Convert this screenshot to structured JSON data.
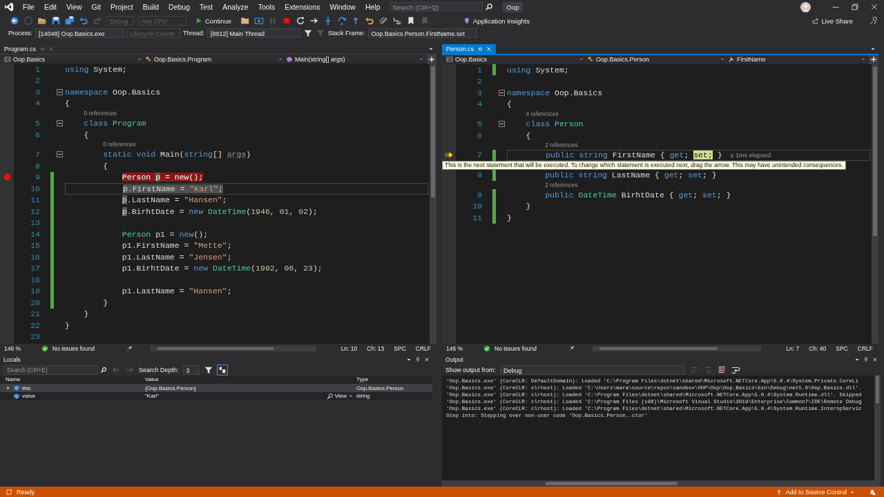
{
  "menu": [
    "File",
    "Edit",
    "View",
    "Git",
    "Project",
    "Build",
    "Debug",
    "Test",
    "Analyze",
    "Tools",
    "Extensions",
    "Window",
    "Help"
  ],
  "search": {
    "placeholder": "Search (Ctrl+Q)"
  },
  "solution_name": "Oop",
  "toolbar": {
    "configuration": {
      "text": "Debug",
      "disabled": true
    },
    "platform": {
      "text": "Any CPU",
      "disabled": true
    },
    "continue_label": "Continue",
    "insights_label": "Application Insights",
    "live_share_label": "Live Share"
  },
  "debug_location": {
    "process_label": "Process:",
    "process": "[14048] Oop.Basics.exe",
    "lifecycle": {
      "text": "Lifecycle Events",
      "disabled": true
    },
    "thread_label": "Thread:",
    "thread": "[8912] Main Thread",
    "stack_frame_label": "Stack Frame:",
    "stack_frame": "Oop.Basics.Person.FirstName.set"
  },
  "editors": [
    {
      "tab": {
        "label": "Program.cs",
        "selected": false
      },
      "nav": [
        {
          "text": "Oop.Basics",
          "kind": "project"
        },
        {
          "text": "Oop.Basics.Program",
          "kind": "class"
        },
        {
          "text": "Main(string[] args)",
          "kind": "method"
        }
      ],
      "lines": [
        {
          "kind": "code",
          "number": "1",
          "changed": false,
          "fold": false,
          "breakpoint": false,
          "next": false,
          "current": false,
          "caller": false,
          "tokens": [
            {
              "text": "using",
              "kind": "kw"
            },
            {
              "text": " System;",
              "kind": "plain"
            }
          ]
        },
        {
          "kind": "code",
          "number": "2",
          "changed": false,
          "fold": false,
          "breakpoint": false,
          "next": false,
          "current": false,
          "caller": false
        },
        {
          "kind": "code",
          "number": "3",
          "changed": false,
          "fold": true,
          "breakpoint": false,
          "next": false,
          "current": false,
          "caller": false,
          "tokens": [
            {
              "text": "namespace",
              "kind": "kw"
            },
            {
              "text": " Oop.Basics",
              "kind": "plain"
            }
          ]
        },
        {
          "kind": "code",
          "number": "4",
          "changed": false,
          "fold": false,
          "breakpoint": false,
          "next": false,
          "current": false,
          "caller": false,
          "tokens": [
            {
              "text": "{",
              "kind": "plain"
            }
          ]
        },
        {
          "kind": "lens",
          "text": "    0 references"
        },
        {
          "kind": "code",
          "number": "5",
          "changed": false,
          "fold": true,
          "breakpoint": false,
          "next": false,
          "current": false,
          "caller": false,
          "tokens": [
            {
              "text": "    class",
              "kind": "kw"
            },
            {
              "text": " Program",
              "kind": "type"
            }
          ]
        },
        {
          "kind": "code",
          "number": "6",
          "changed": false,
          "fold": false,
          "breakpoint": false,
          "next": false,
          "current": false,
          "caller": false,
          "tokens": [
            {
              "text": "    {",
              "kind": "plain"
            }
          ]
        },
        {
          "kind": "lens",
          "text": "        0 references"
        },
        {
          "kind": "code",
          "number": "7",
          "changed": false,
          "fold": true,
          "breakpoint": false,
          "next": false,
          "current": false,
          "caller": false,
          "tokens": [
            {
              "text": "        static",
              "kind": "kw"
            },
            {
              "text": " void",
              "kind": "kw"
            },
            {
              "text": " Main(",
              "kind": "plain"
            },
            {
              "text": "string",
              "kind": "kw"
            },
            {
              "text": "[] ",
              "kind": "plain"
            },
            {
              "text": "args",
              "kind": "unused"
            },
            {
              "text": ")",
              "kind": "plain"
            }
          ]
        },
        {
          "kind": "code",
          "number": "8",
          "changed": false,
          "fold": false,
          "breakpoint": false,
          "next": false,
          "current": false,
          "caller": false,
          "tokens": [
            {
              "text": "        {",
              "kind": "plain"
            }
          ]
        },
        {
          "kind": "code",
          "number": "9",
          "changed": true,
          "fold": false,
          "breakpoint": true,
          "next": false,
          "current": false,
          "caller": false,
          "tokens": [
            {
              "text": "            Person ",
              "kind": "plain"
            },
            {
              "text": "p",
              "kind": "ref"
            },
            {
              "text": " = new();",
              "kind": "plain"
            }
          ]
        },
        {
          "kind": "code",
          "number": "10",
          "changed": true,
          "fold": false,
          "breakpoint": false,
          "next": false,
          "current": true,
          "caller": true,
          "tokens": [
            {
              "text": "            p",
              "kind": "ref"
            },
            {
              "text": ".FirstName = ",
              "kind": "plain"
            },
            {
              "text": "\"Karl\"",
              "kind": "str"
            },
            {
              "text": ";",
              "kind": "plain"
            }
          ]
        },
        {
          "kind": "code",
          "number": "11",
          "changed": true,
          "fold": false,
          "breakpoint": false,
          "next": false,
          "current": false,
          "caller": false,
          "tokens": [
            {
              "text": "            p",
              "kind": "ref"
            },
            {
              "text": ".LastName = ",
              "kind": "plain"
            },
            {
              "text": "\"Hansen\"",
              "kind": "str"
            },
            {
              "text": ";",
              "kind": "plain"
            }
          ]
        },
        {
          "kind": "code",
          "number": "12",
          "changed": true,
          "fold": false,
          "breakpoint": false,
          "next": false,
          "current": false,
          "caller": false,
          "tokens": [
            {
              "text": "            p",
              "kind": "ref"
            },
            {
              "text": ".BirhtDate = ",
              "kind": "plain"
            },
            {
              "text": "new",
              "kind": "kw"
            },
            {
              "text": " DateTime",
              "kind": "type"
            },
            {
              "text": "(",
              "kind": "plain"
            },
            {
              "text": "1946",
              "kind": "num"
            },
            {
              "text": ", ",
              "kind": "plain"
            },
            {
              "text": "01",
              "kind": "num"
            },
            {
              "text": ", ",
              "kind": "plain"
            },
            {
              "text": "02",
              "kind": "num"
            },
            {
              "text": ");",
              "kind": "plain"
            }
          ]
        },
        {
          "kind": "code",
          "number": "13",
          "changed": true,
          "fold": false,
          "breakpoint": false,
          "next": false,
          "current": false,
          "caller": false
        },
        {
          "kind": "code",
          "number": "14",
          "changed": true,
          "fold": false,
          "breakpoint": false,
          "next": false,
          "current": false,
          "caller": false,
          "tokens": [
            {
              "text": "            Person",
              "kind": "type"
            },
            {
              "text": " p1 = ",
              "kind": "plain"
            },
            {
              "text": "new",
              "kind": "kw"
            },
            {
              "text": "();",
              "kind": "plain"
            }
          ]
        },
        {
          "kind": "code",
          "number": "15",
          "changed": true,
          "fold": false,
          "breakpoint": false,
          "next": false,
          "current": false,
          "caller": false,
          "tokens": [
            {
              "text": "            p1.FirstName = ",
              "kind": "plain"
            },
            {
              "text": "\"Mette\"",
              "kind": "str"
            },
            {
              "text": ";",
              "kind": "plain"
            }
          ]
        },
        {
          "kind": "code",
          "number": "16",
          "changed": true,
          "fold": false,
          "breakpoint": false,
          "next": false,
          "current": false,
          "caller": false,
          "tokens": [
            {
              "text": "            p1.LastName = ",
              "kind": "plain"
            },
            {
              "text": "\"Jensen\"",
              "kind": "str"
            },
            {
              "text": ";",
              "kind": "plain"
            }
          ]
        },
        {
          "kind": "code",
          "number": "17",
          "changed": true,
          "fold": false,
          "breakpoint": false,
          "next": false,
          "current": false,
          "caller": false,
          "tokens": [
            {
              "text": "            p1.BirhtDate = ",
              "kind": "plain"
            },
            {
              "text": "new",
              "kind": "kw"
            },
            {
              "text": " DateTime",
              "kind": "type"
            },
            {
              "text": "(",
              "kind": "plain"
            },
            {
              "text": "1992",
              "kind": "num"
            },
            {
              "text": ", ",
              "kind": "plain"
            },
            {
              "text": "06",
              "kind": "num"
            },
            {
              "text": ", ",
              "kind": "plain"
            },
            {
              "text": "23",
              "kind": "num"
            },
            {
              "text": ");",
              "kind": "plain"
            }
          ]
        },
        {
          "kind": "code",
          "number": "18",
          "changed": true,
          "fold": false,
          "breakpoint": false,
          "next": false,
          "current": false,
          "caller": false
        },
        {
          "kind": "code",
          "number": "19",
          "changed": true,
          "fold": false,
          "breakpoint": false,
          "next": false,
          "current": false,
          "caller": false,
          "tokens": [
            {
              "text": "            p1.LastName = ",
              "kind": "plain"
            },
            {
              "text": "\"Hansen\"",
              "kind": "str"
            },
            {
              "text": ";",
              "kind": "plain"
            }
          ]
        },
        {
          "kind": "code",
          "number": "20",
          "changed": true,
          "fold": false,
          "breakpoint": false,
          "next": false,
          "current": false,
          "caller": false,
          "tokens": [
            {
              "text": "        }",
              "kind": "plain"
            }
          ]
        },
        {
          "kind": "code",
          "number": "21",
          "changed": false,
          "fold": false,
          "breakpoint": false,
          "next": false,
          "current": false,
          "caller": false,
          "tokens": [
            {
              "text": "    }",
              "kind": "plain"
            }
          ]
        },
        {
          "kind": "code",
          "number": "22",
          "changed": false,
          "fold": false,
          "breakpoint": false,
          "next": false,
          "current": false,
          "caller": false,
          "tokens": [
            {
              "text": "}",
              "kind": "plain"
            }
          ]
        },
        {
          "kind": "code",
          "number": "23",
          "changed": false,
          "fold": false,
          "breakpoint": false,
          "next": false,
          "current": false,
          "caller": false
        }
      ],
      "status": {
        "zoom": "146 %",
        "issues": "No issues found",
        "line": "Ln: 10",
        "column": "Ch: 13",
        "indent": "SPC",
        "line_ending": "CRLF"
      }
    },
    {
      "tab": {
        "label": "Person.cs",
        "selected": true
      },
      "nav": [
        {
          "text": "Oop.Basics",
          "kind": "project"
        },
        {
          "text": "Oop.Basics.Person",
          "kind": "class"
        },
        {
          "text": "FirstName",
          "kind": "property"
        }
      ],
      "lines": [
        {
          "kind": "code",
          "number": "1",
          "changed": true,
          "fold": false,
          "breakpoint": false,
          "next": false,
          "current": false,
          "caller": false,
          "tokens": [
            {
              "text": "using",
              "kind": "kw"
            },
            {
              "text": " System;",
              "kind": "plain"
            }
          ]
        },
        {
          "kind": "code",
          "number": "2",
          "changed": false,
          "fold": false,
          "breakpoint": false,
          "next": false,
          "current": false,
          "caller": false
        },
        {
          "kind": "code",
          "number": "3",
          "changed": false,
          "fold": true,
          "breakpoint": false,
          "next": false,
          "current": false,
          "caller": false,
          "tokens": [
            {
              "text": "namespace",
              "kind": "kw"
            },
            {
              "text": " Oop.Basics",
              "kind": "plain"
            }
          ]
        },
        {
          "kind": "code",
          "number": "4",
          "changed": false,
          "fold": false,
          "breakpoint": false,
          "next": false,
          "current": false,
          "caller": false,
          "tokens": [
            {
              "text": "{",
              "kind": "plain"
            }
          ]
        },
        {
          "kind": "lens",
          "text": "    4 references"
        },
        {
          "kind": "code",
          "number": "5",
          "changed": false,
          "fold": true,
          "breakpoint": false,
          "next": false,
          "current": false,
          "caller": false,
          "tokens": [
            {
              "text": "    class",
              "kind": "kw"
            },
            {
              "text": " Person",
              "kind": "type"
            }
          ]
        },
        {
          "kind": "code",
          "number": "6",
          "changed": false,
          "fold": false,
          "breakpoint": false,
          "next": false,
          "current": false,
          "caller": false,
          "tokens": [
            {
              "text": "    {",
              "kind": "plain"
            }
          ]
        },
        {
          "kind": "lens",
          "text": "        2 references"
        },
        {
          "kind": "code",
          "number": "7",
          "changed": true,
          "fold": false,
          "breakpoint": false,
          "next": true,
          "current": true,
          "caller": false,
          "tip": "≤ 1ms elapsed",
          "tokens": [
            {
              "text": "        public",
              "kind": "kw"
            },
            {
              "text": " string",
              "kind": "kw"
            },
            {
              "text": " FirstName { ",
              "kind": "plain"
            },
            {
              "text": "get",
              "kind": "kw"
            },
            {
              "text": "; ",
              "kind": "plain"
            },
            {
              "text": "set;",
              "kind": "hl"
            },
            {
              "text": " }",
              "kind": "plain"
            }
          ]
        },
        {
          "kind": "tooltip",
          "text": "This is the next statement that will be executed. To change which statement is executed next, drag the arrow. This may have unintended consequences."
        },
        {
          "kind": "code",
          "number": "8",
          "changed": true,
          "fold": false,
          "breakpoint": false,
          "next": false,
          "current": false,
          "caller": false,
          "tokens": [
            {
              "text": "        public",
              "kind": "kw"
            },
            {
              "text": " string",
              "kind": "kw"
            },
            {
              "text": " LastName { ",
              "kind": "plain"
            },
            {
              "text": "get",
              "kind": "kw"
            },
            {
              "text": "; ",
              "kind": "plain"
            },
            {
              "text": "set",
              "kind": "kw"
            },
            {
              "text": "; }",
              "kind": "plain"
            }
          ]
        },
        {
          "kind": "lens",
          "text": "        2 references"
        },
        {
          "kind": "code",
          "number": "9",
          "changed": true,
          "fold": false,
          "breakpoint": false,
          "next": false,
          "current": false,
          "caller": false,
          "tokens": [
            {
              "text": "        public",
              "kind": "kw"
            },
            {
              "text": " DateTime",
              "kind": "type"
            },
            {
              "text": " BirhtDate { ",
              "kind": "plain"
            },
            {
              "text": "get",
              "kind": "kw"
            },
            {
              "text": "; ",
              "kind": "plain"
            },
            {
              "text": "set",
              "kind": "kw"
            },
            {
              "text": "; }",
              "kind": "plain"
            }
          ]
        },
        {
          "kind": "code",
          "number": "10",
          "changed": true,
          "fold": false,
          "breakpoint": false,
          "next": false,
          "current": false,
          "caller": false,
          "tokens": [
            {
              "text": "    }",
              "kind": "plain"
            }
          ]
        },
        {
          "kind": "code",
          "number": "11",
          "changed": true,
          "fold": false,
          "breakpoint": false,
          "next": false,
          "current": false,
          "caller": false,
          "tokens": [
            {
              "text": "}",
              "kind": "plain"
            }
          ]
        }
      ],
      "status": {
        "zoom": "146 %",
        "issues": "No issues found",
        "line": "Ln: 7",
        "column": "Ch: 40",
        "indent": "SPC",
        "line_ending": "CRLF"
      }
    }
  ],
  "locals": {
    "title": "Locals",
    "search": {
      "placeholder": "Search (Ctrl+E)"
    },
    "depth_label": "Search Depth:",
    "depth": "3",
    "columns": [
      "Name",
      "Value",
      "Type"
    ],
    "rows": [
      {
        "name": "this",
        "value": "{Oop.Basics.Person}",
        "type": "Oop.Basics.Person",
        "expandable": true,
        "selected": true
      },
      {
        "name": "value",
        "value": "\"Karl\"",
        "type": "string",
        "expandable": false,
        "selected": false,
        "visualizer": "View"
      }
    ]
  },
  "output": {
    "title": "Output",
    "source_label": "Show output from:",
    "source": "Debug",
    "lines": [
      "'Oop.Basics.exe' (CoreCLR: DefaultDomain): Loaded 'C:\\Program Files\\dotnet\\shared\\Microsoft.NETCore.App\\5.0.4\\System.Private.CoreLi",
      "'Oop.Basics.exe' (CoreCLR: clrhost): Loaded 'C:\\Users\\mara\\source\\repos\\sandbox\\OOP\\Oop\\Oop.Basics\\bin\\Debug\\net5.0\\Oop.Basics.dll'.",
      "'Oop.Basics.exe' (CoreCLR: clrhost): Loaded 'C:\\Program Files\\dotnet\\shared\\Microsoft.NETCore.App\\5.0.4\\System.Runtime.dll'. Skipped",
      "'Oop.Basics.exe' (CoreCLR: clrhost): Loaded 'C:\\Program Files (x86)\\Microsoft Visual Studio\\2019\\Enterprise\\Common7\\IDE\\Remote Debug",
      "'Oop.Basics.exe' (CoreCLR: clrhost): Loaded 'C:\\Program Files\\dotnet\\shared\\Microsoft.NETCore.App\\5.0.4\\System.Runtime.InteropServic",
      "Step into: Stepping over non-user code 'Oop.Basics.Person..ctor'"
    ]
  },
  "status_bar": {
    "text": "Ready",
    "source_control": "Add to Source Control"
  }
}
